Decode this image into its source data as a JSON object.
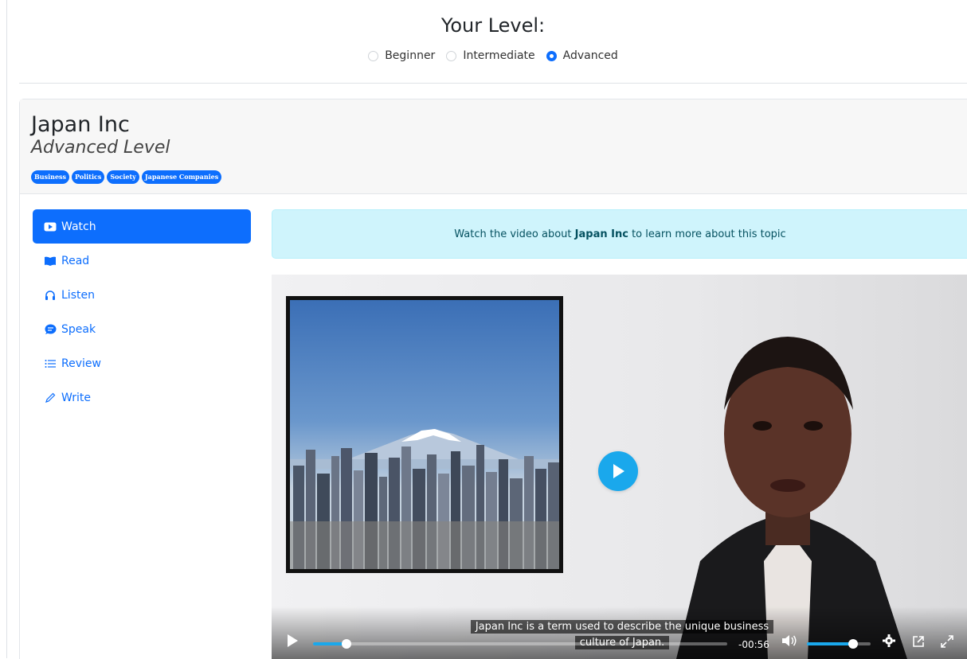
{
  "level_selector": {
    "title": "Your Level:",
    "options": [
      {
        "label": "Beginner",
        "checked": false
      },
      {
        "label": "Intermediate",
        "checked": false
      },
      {
        "label": "Advanced",
        "checked": true
      }
    ]
  },
  "topic": {
    "title": "Japan Inc",
    "level": "Advanced Level",
    "tags": [
      "Business",
      "Politics",
      "Society",
      "Japanese Companies"
    ]
  },
  "nav": {
    "items": [
      {
        "label": "Watch",
        "icon": "video-icon",
        "active": true
      },
      {
        "label": "Read",
        "icon": "book-icon",
        "active": false
      },
      {
        "label": "Listen",
        "icon": "headphones-icon",
        "active": false
      },
      {
        "label": "Speak",
        "icon": "chat-icon",
        "active": false
      },
      {
        "label": "Review",
        "icon": "list-icon",
        "active": false
      },
      {
        "label": "Write",
        "icon": "pencil-icon",
        "active": false
      }
    ]
  },
  "alert": {
    "prefix": "Watch the video about ",
    "topic": "Japan Inc",
    "suffix": " to learn more about this topic"
  },
  "video": {
    "caption_line1": "Japan Inc is a term used to describe the unique business",
    "caption_line2": "culture of Japan.",
    "time_remaining": "-00:56",
    "progress_fraction": 0.08,
    "volume_fraction": 0.72
  },
  "colors": {
    "primary": "#0d6efd",
    "alert_bg": "#cff4fc",
    "alert_text": "#055160",
    "player_accent": "#1aa8ec"
  }
}
